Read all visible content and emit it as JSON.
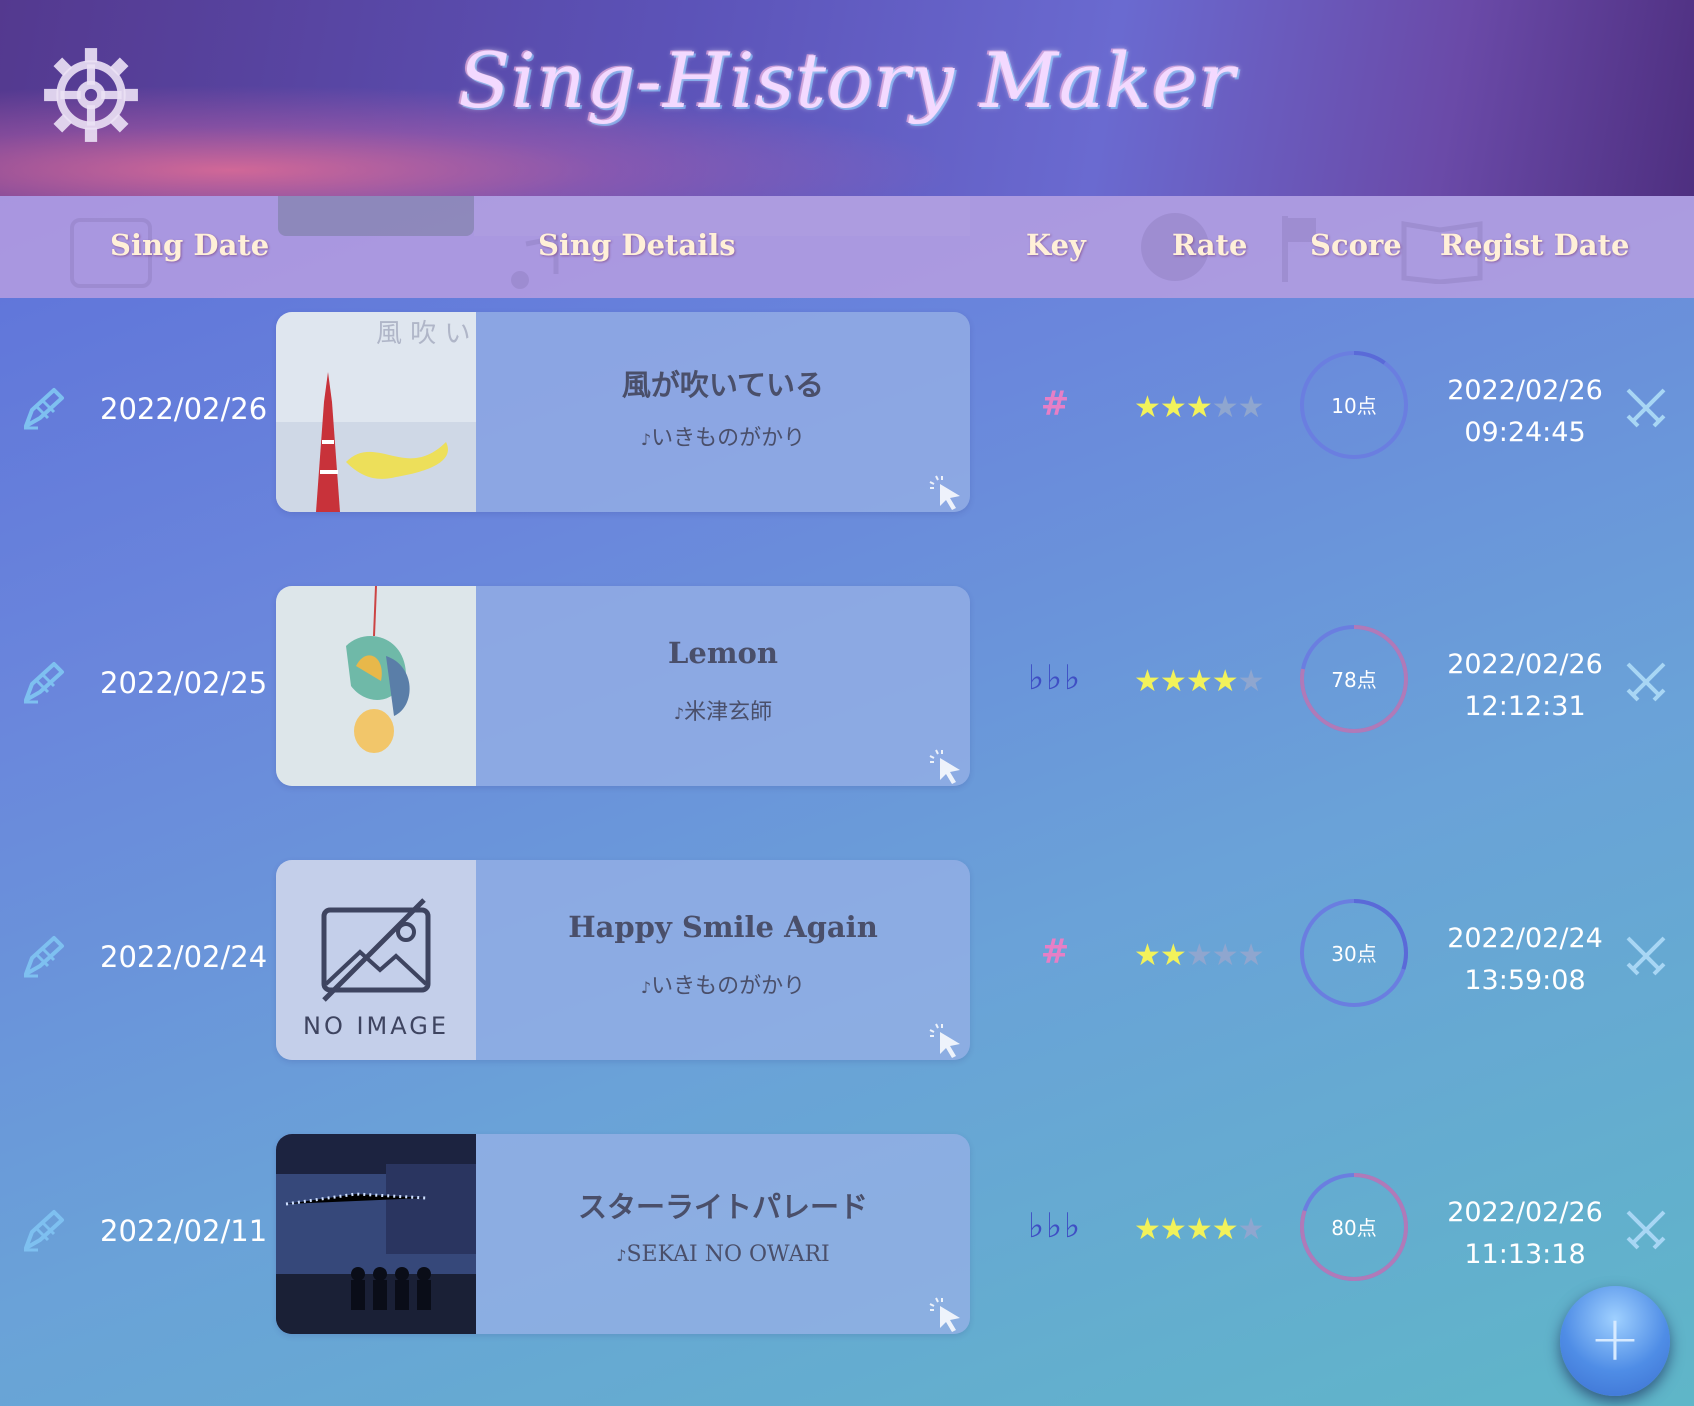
{
  "app": {
    "title": "Sing-History Maker"
  },
  "columns": {
    "sing_date": "Sing Date",
    "sing_details": "Sing Details",
    "key": "Key",
    "rate": "Rate",
    "score": "Score",
    "regist_date": "Regist Date"
  },
  "rows": [
    {
      "sing_date": "2022/02/26",
      "title": "風が吹いている",
      "artist": "いきものがかり",
      "key": "#",
      "rating": 3,
      "score": "10点",
      "score_value": 10,
      "regist_date": "2022/02/26",
      "regist_time": "09:24:45",
      "thumb_text": "風 吹 い い",
      "thumb": "tokyo-tower-yellow-scarf"
    },
    {
      "sing_date": "2022/02/25",
      "title": "Lemon",
      "artist": "米津玄師",
      "key": "♭♭♭",
      "rating": 4,
      "score": "78点",
      "score_value": 78,
      "regist_date": "2022/02/26",
      "regist_time": "12:12:31",
      "thumb": "lemon-painting"
    },
    {
      "sing_date": "2022/02/24",
      "title": "Happy Smile Again",
      "artist": "いきものがかり",
      "key": "#",
      "rating": 2,
      "score": "30点",
      "score_value": 30,
      "regist_date": "2022/02/24",
      "regist_time": "13:59:08",
      "thumb_text": "NO IMAGE",
      "thumb": "no-image"
    },
    {
      "sing_date": "2022/02/11",
      "title": "スターライトパレード",
      "artist": "SEKAI NO OWARI",
      "key": "♭♭♭",
      "rating": 4,
      "score": "80点",
      "score_value": 80,
      "regist_date": "2022/02/26",
      "regist_time": "11:13:18",
      "thumb": "night-parade-photo"
    }
  ],
  "fab": {
    "label": "+"
  },
  "colors": {
    "sharp": "#e77fc6",
    "flat": "#3f4fc4",
    "star_on": "#f2f25a",
    "star_off": "#8fa6cf"
  }
}
